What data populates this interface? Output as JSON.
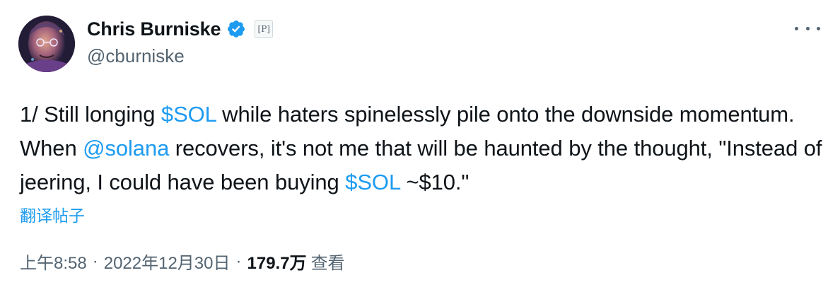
{
  "author": {
    "display_name": "Chris Burniske",
    "handle": "@cburniske",
    "affiliate_badge": "[P]",
    "avatar_icon": "avatar-portrait",
    "verified_icon": "verified-badge-icon"
  },
  "tweet": {
    "segments": [
      {
        "text": "1/ Still longing ",
        "link": false
      },
      {
        "text": "$SOL",
        "link": true
      },
      {
        "text": " while haters spinelessly pile onto the downside momentum. When ",
        "link": false
      },
      {
        "text": "@solana",
        "link": true
      },
      {
        "text": " recovers, it's not me that will be haunted by the thought, \"Instead of jeering, I could have been buying ",
        "link": false
      },
      {
        "text": "$SOL",
        "link": true
      },
      {
        "text": " ~$10.\"",
        "link": false
      }
    ],
    "translate_label": "翻译帖子"
  },
  "meta": {
    "time": "上午8:58",
    "separator": "·",
    "date": "2022年12月30日",
    "views_count": "179.7万",
    "views_label": "查看"
  },
  "colors": {
    "link": "#1d9bf0",
    "text": "#0f1419",
    "secondary": "#536471"
  }
}
